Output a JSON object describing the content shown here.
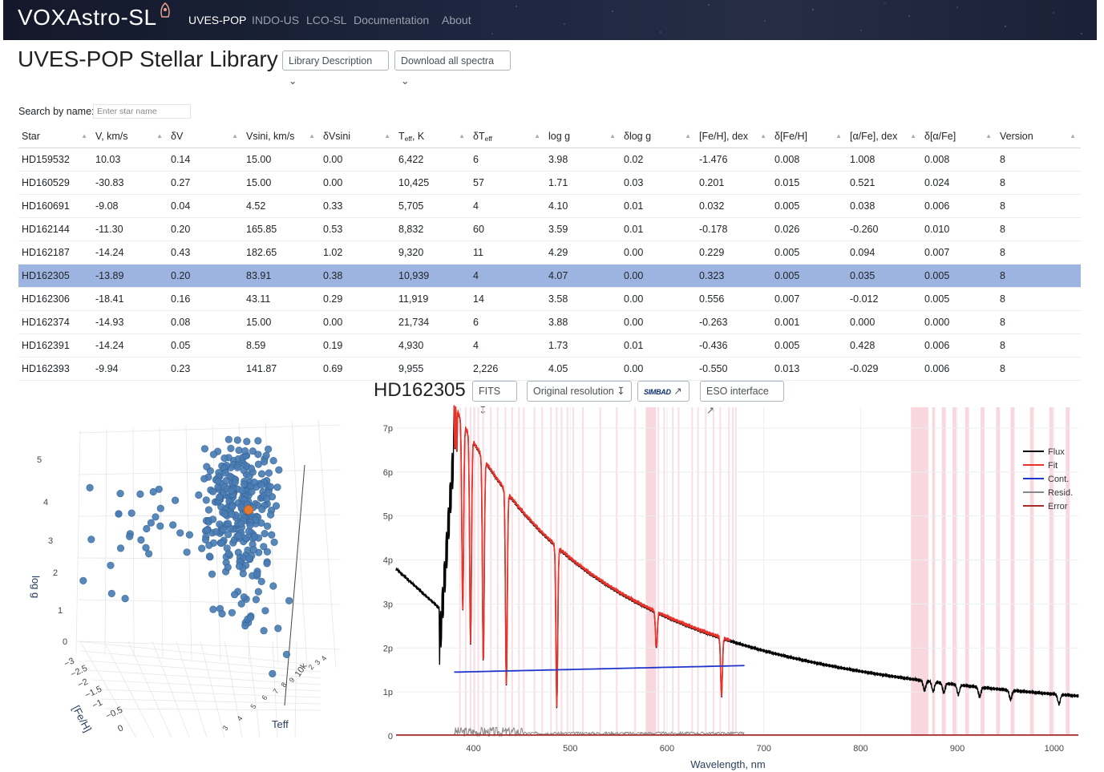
{
  "nav": {
    "brand": "VOXAstro-SL",
    "items": [
      "UVES-POP",
      "INDO-US",
      "LCO-SL",
      "Documentation",
      "About"
    ]
  },
  "header": {
    "title": "UVES-POP Stellar Library",
    "library_description": "Library Description",
    "download_all": "Download all spectra"
  },
  "search": {
    "label": "Search by name:",
    "placeholder": "Enter star name"
  },
  "table": {
    "columns": {
      "star": "Star",
      "v": "V, km/s",
      "dv": "δV",
      "vsini": "Vsini, km/s",
      "dvsini": "δVsini",
      "teff_main": "T",
      "teff_sub": "eff",
      "teff_unit": ", K",
      "dteff_main": "δT",
      "dteff_sub": "eff",
      "logg": "log g",
      "dlogg": "δlog g",
      "feh": "[Fe/H], dex",
      "dfeh": "δ[Fe/H]",
      "afe": "[α/Fe], dex",
      "dafe": "δ[α/Fe]",
      "version": "Version"
    },
    "rows": [
      [
        "HD159532",
        "10.03",
        "0.14",
        "15.00",
        "0.00",
        "6,422",
        "6",
        "3.98",
        "0.02",
        "-1.476",
        "0.008",
        "1.008",
        "0.008",
        "8"
      ],
      [
        "HD160529",
        "-30.83",
        "0.27",
        "15.00",
        "0.00",
        "10,425",
        "57",
        "1.71",
        "0.03",
        "0.201",
        "0.015",
        "0.521",
        "0.024",
        "8"
      ],
      [
        "HD160691",
        "-9.08",
        "0.04",
        "4.52",
        "0.33",
        "5,705",
        "4",
        "4.10",
        "0.01",
        "0.032",
        "0.005",
        "0.038",
        "0.006",
        "8"
      ],
      [
        "HD162144",
        "-11.30",
        "0.20",
        "165.85",
        "0.53",
        "8,832",
        "60",
        "3.59",
        "0.01",
        "-0.178",
        "0.026",
        "-0.260",
        "0.010",
        "8"
      ],
      [
        "HD162187",
        "-14.24",
        "0.43",
        "182.65",
        "1.02",
        "9,320",
        "11",
        "4.29",
        "0.00",
        "0.229",
        "0.005",
        "0.094",
        "0.007",
        "8"
      ],
      [
        "HD162305",
        "-13.89",
        "0.20",
        "83.91",
        "0.38",
        "10,939",
        "4",
        "4.07",
        "0.00",
        "0.323",
        "0.005",
        "0.035",
        "0.005",
        "8"
      ],
      [
        "HD162306",
        "-18.41",
        "0.16",
        "43.11",
        "0.29",
        "11,919",
        "14",
        "3.58",
        "0.00",
        "0.556",
        "0.007",
        "-0.012",
        "0.005",
        "8"
      ],
      [
        "HD162374",
        "-14.93",
        "0.08",
        "15.00",
        "0.00",
        "21,734",
        "6",
        "3.88",
        "0.00",
        "-0.263",
        "0.001",
        "0.000",
        "0.000",
        "8"
      ],
      [
        "HD162391",
        "-14.24",
        "0.05",
        "8.59",
        "0.19",
        "4,930",
        "4",
        "1.73",
        "0.01",
        "-0.436",
        "0.005",
        "0.428",
        "0.006",
        "8"
      ],
      [
        "HD162393",
        "-9.94",
        "0.23",
        "141.87",
        "0.69",
        "9,955",
        "2,226",
        "4.05",
        "0.00",
        "-0.550",
        "0.013",
        "-0.029",
        "0.006",
        "8"
      ]
    ],
    "selected_row": 5
  },
  "detail": {
    "star": "HD162305",
    "fits": "FITS",
    "original": "Original resolution",
    "simbad": "SIMBAD",
    "eso": "ESO interface"
  },
  "plot3d": {
    "z_title": "log g",
    "x_title": "[Fe/H]",
    "y_title": "Teff",
    "z_ticks": [
      "0",
      "1",
      "2",
      "3",
      "4",
      "5"
    ],
    "x_ticks": [
      "−3",
      "−2.5",
      "−2",
      "−1.5",
      "−1",
      "−0.5",
      "0"
    ],
    "y_ticks": [
      "3",
      "4",
      "5",
      "6",
      "7",
      "8",
      "9",
      "10k",
      "2",
      "3",
      "4"
    ]
  },
  "spectrum": {
    "x_title": "Wavelength, nm",
    "x_ticks": [
      "400",
      "500",
      "600",
      "700",
      "800",
      "900",
      "1000"
    ],
    "y_ticks": [
      "0",
      "1p",
      "2p",
      "3p",
      "4p",
      "5p",
      "6p",
      "7p"
    ],
    "legend": [
      {
        "name": "Flux",
        "color": "#000000"
      },
      {
        "name": "Fit",
        "color": "#e8322a"
      },
      {
        "name": "Cont.",
        "color": "#1f35cc"
      },
      {
        "name": "Resid.",
        "color": "#888888"
      },
      {
        "name": "Error",
        "color": "#a52a2a"
      }
    ]
  }
}
